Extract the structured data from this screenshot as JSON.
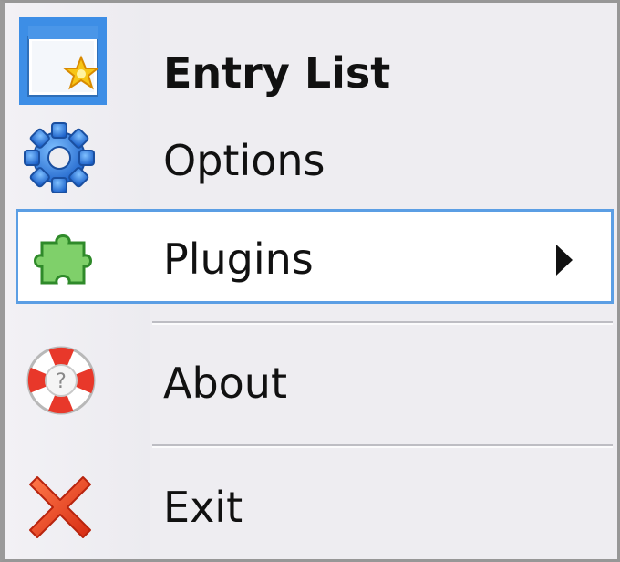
{
  "menu": {
    "items": [
      {
        "label": "Entry List",
        "icon": "new-window-icon",
        "bold": true
      },
      {
        "label": "Options",
        "icon": "gear-icon"
      },
      {
        "label": "Plugins",
        "icon": "puzzle-piece-icon",
        "highlighted": true,
        "has_submenu": true
      },
      {
        "label": "About",
        "icon": "lifebuoy-help-icon"
      },
      {
        "label": "Exit",
        "icon": "red-x-icon"
      }
    ]
  },
  "colors": {
    "menu_background": "#eeedf1",
    "highlight_background": "#ffffff",
    "highlight_border": "#5b9ee4",
    "separator": "#bdbdc3",
    "text": "#111111"
  }
}
